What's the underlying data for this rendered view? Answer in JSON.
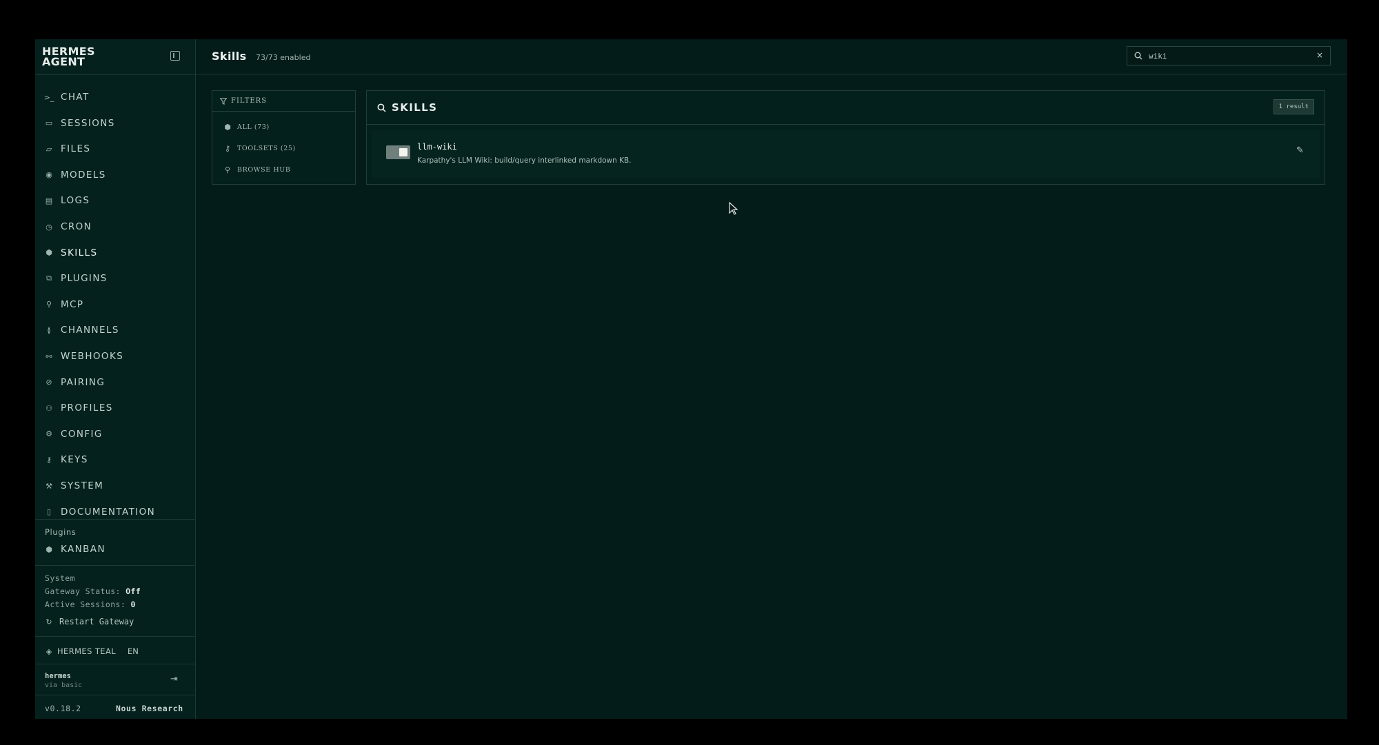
{
  "brand": {
    "line1": "HERMES",
    "line2": "AGENT"
  },
  "nav": [
    {
      "label": "CHAT",
      "icon": ">_"
    },
    {
      "label": "SESSIONS",
      "icon": "▭"
    },
    {
      "label": "FILES",
      "icon": "▱"
    },
    {
      "label": "MODELS",
      "icon": "◉"
    },
    {
      "label": "LOGS",
      "icon": "▤"
    },
    {
      "label": "CRON",
      "icon": "◷"
    },
    {
      "label": "SKILLS",
      "icon": "⬢"
    },
    {
      "label": "PLUGINS",
      "icon": "⧉"
    },
    {
      "label": "MCP",
      "icon": "⚲"
    },
    {
      "label": "CHANNELS",
      "icon": "≬"
    },
    {
      "label": "WEBHOOKS",
      "icon": "⚯"
    },
    {
      "label": "PAIRING",
      "icon": "⊘"
    },
    {
      "label": "PROFILES",
      "icon": "⚇"
    },
    {
      "label": "CONFIG",
      "icon": "⚙"
    },
    {
      "label": "KEYS",
      "icon": "⚷"
    },
    {
      "label": "SYSTEM",
      "icon": "⚒"
    },
    {
      "label": "DOCUMENTATION",
      "icon": "▯"
    }
  ],
  "plugins_section": {
    "label": "Plugins",
    "items": [
      {
        "label": "KANBAN",
        "icon": "⬢"
      }
    ]
  },
  "system": {
    "label": "System",
    "gateway_status_label": "Gateway Status:",
    "gateway_status_value": "Off",
    "active_sessions_label": "Active Sessions:",
    "active_sessions_value": "0",
    "restart_label": "Restart Gateway"
  },
  "theme": {
    "label": "HERMES TEAL",
    "lang": "EN"
  },
  "user": {
    "name": "hermes",
    "via": "via basic"
  },
  "footer": {
    "version": "v0.18.2",
    "org": "Nous Research"
  },
  "header": {
    "title": "Skills",
    "subtitle": "73/73 enabled"
  },
  "search": {
    "value": "wiki",
    "clear_icon": "×"
  },
  "filters": {
    "title": "FILTERS",
    "items": [
      {
        "label": "ALL (73)",
        "icon": "⬢"
      },
      {
        "label": "TOOLSETS (25)",
        "icon": "⚷"
      },
      {
        "label": "BROWSE HUB",
        "icon": "⚲"
      }
    ]
  },
  "skills_panel": {
    "title": "SKILLS",
    "result_count": "1 result",
    "items": [
      {
        "name": "llm-wiki",
        "description": "Karpathy's LLM Wiki: build/query interlinked markdown KB.",
        "enabled": true
      }
    ]
  },
  "colors": {
    "background": "#041c19",
    "sidebar": "#04211d",
    "border": "#1d3a35",
    "text": "#c9d6d1"
  }
}
